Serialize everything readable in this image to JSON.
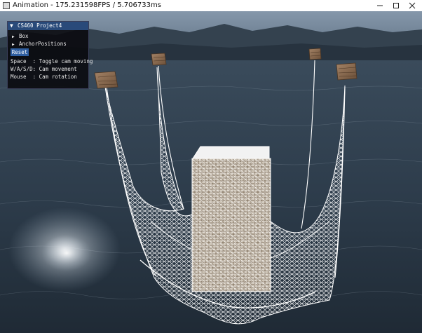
{
  "window": {
    "title": "Animation - 175.231598FPS / 5.706733ms",
    "controls": [
      "minimize",
      "maximize",
      "close"
    ]
  },
  "panel": {
    "title": "CS460 Project4",
    "tree_items": [
      {
        "label": "Box"
      },
      {
        "label": "AnchorPositions"
      }
    ],
    "reset_label": "Reset",
    "help_lines": [
      {
        "key": "Space",
        "sep": "  :",
        "text": " Toggle cam moving"
      },
      {
        "key": "W/A/S/D",
        "sep": ":",
        "text": " Cam movement"
      },
      {
        "key": "Mouse",
        "sep": "  :",
        "text": " Cam rotation"
      }
    ]
  },
  "icons": {
    "app": "app-icon",
    "minimize": "minimize-icon",
    "maximize": "maximize-icon",
    "close": "close-icon",
    "collapse": "triangle-down-icon",
    "expand": "triangle-right-icon"
  },
  "colors": {
    "panel_title_bg": "#294a7a",
    "reset_button": "#2f5ea0",
    "cloth": "#ffffff",
    "crate": "#8a6a4a",
    "water": "#2a3947"
  }
}
